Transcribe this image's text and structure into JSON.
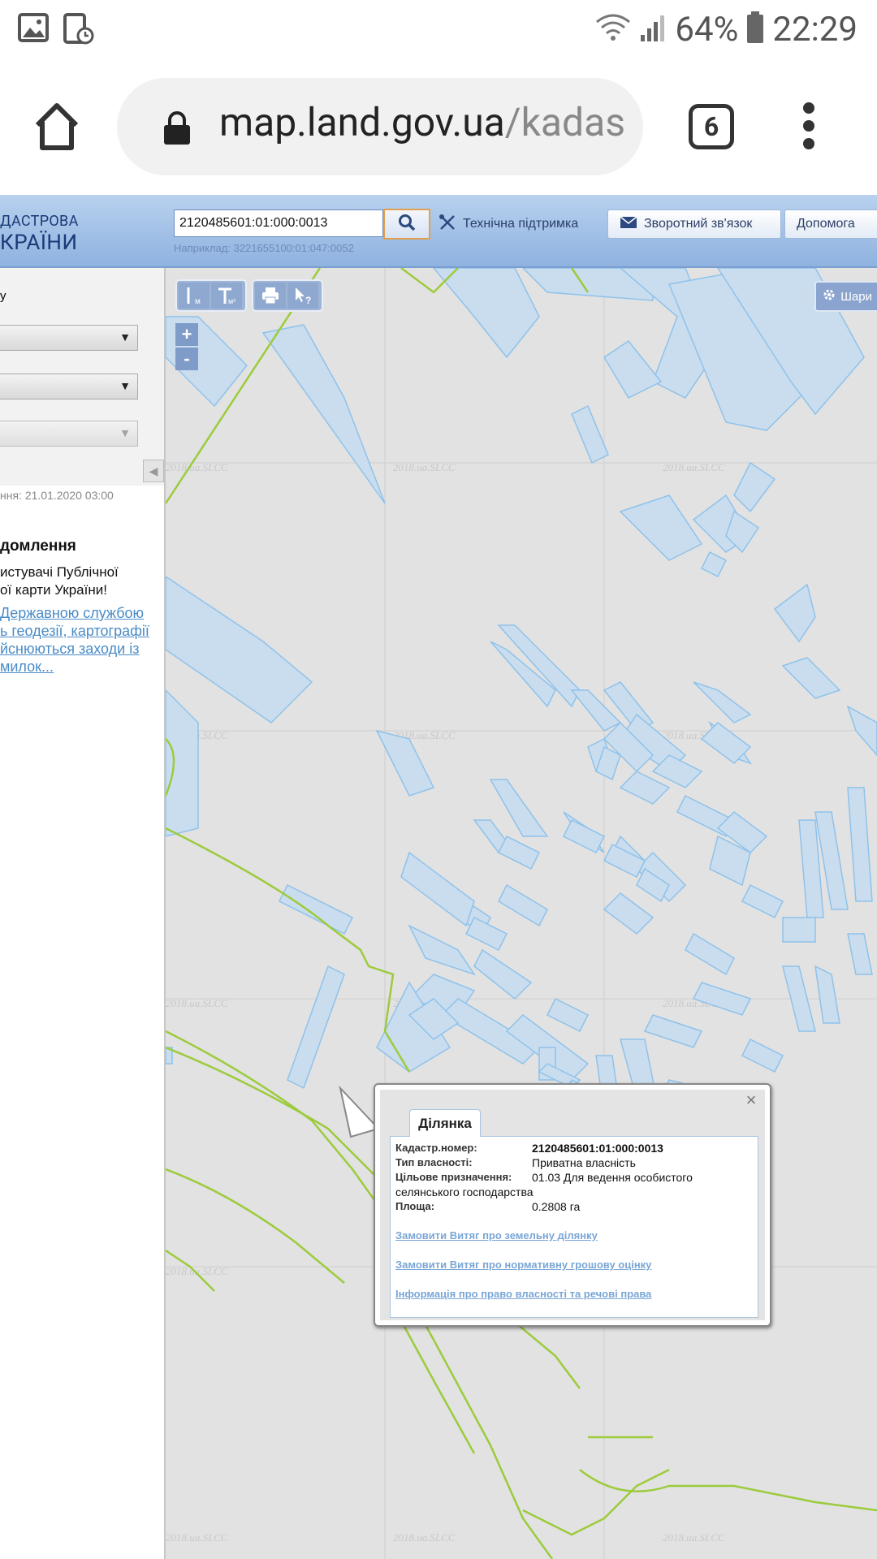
{
  "status_bar": {
    "battery": "64%",
    "time": "22:29"
  },
  "browser": {
    "url_host": "map.land.gov.ua",
    "url_path": "/kadas",
    "tab_count": "6"
  },
  "header": {
    "logo_line1": "ДАСТРОВА",
    "logo_line2": "КРАЇНИ",
    "search_value": "2120485601:01:000:0013",
    "search_hint": "Наприклад: 3221655100:01:047:0052",
    "support_label": "Технічна підтримка",
    "feedback_label": "Зворотний зв'язок",
    "help_label": "Допомога"
  },
  "sidebar": {
    "label": "у",
    "update_time": "ння: 21.01.2020 03:00",
    "notice_title": "домлення",
    "notice_text_1": "истувачі Публічної",
    "notice_text_2": "ої карти України!",
    "notice_link_1": "Державною службою",
    "notice_link_2": "ь геодезії, картографії",
    "notice_link_3": "йснюються заходи із",
    "notice_link_4": "милок..."
  },
  "map": {
    "layers_label": "Шари",
    "zoom_in": "+",
    "zoom_out": "-",
    "watermark": "2018.ua.SLCC",
    "parcel_color": "#c9ddef",
    "parcel_stroke": "#8fc2ea",
    "boundary_color": "#9ccb3c"
  },
  "popup": {
    "tab_label": "Ділянка",
    "close": "×",
    "cadastral_key": "Кадастр.номер:",
    "cadastral_value": "2120485601:01:000:0013",
    "ownership_key": "Тип власності:",
    "ownership_value": "Приватна власність",
    "purpose_key": "Цільове призначення:",
    "purpose_value": "01.03 Для ведення особистого",
    "purpose_value_cont": "селянського господарства",
    "area_key": "Площа:",
    "area_value": "0.2808 га",
    "link_1": "Замовити Витяг про земельну ділянку",
    "link_2": "Замовити Витяг про нормативну грошову оцінку",
    "link_3": "Інформація про право власності та речові права"
  }
}
